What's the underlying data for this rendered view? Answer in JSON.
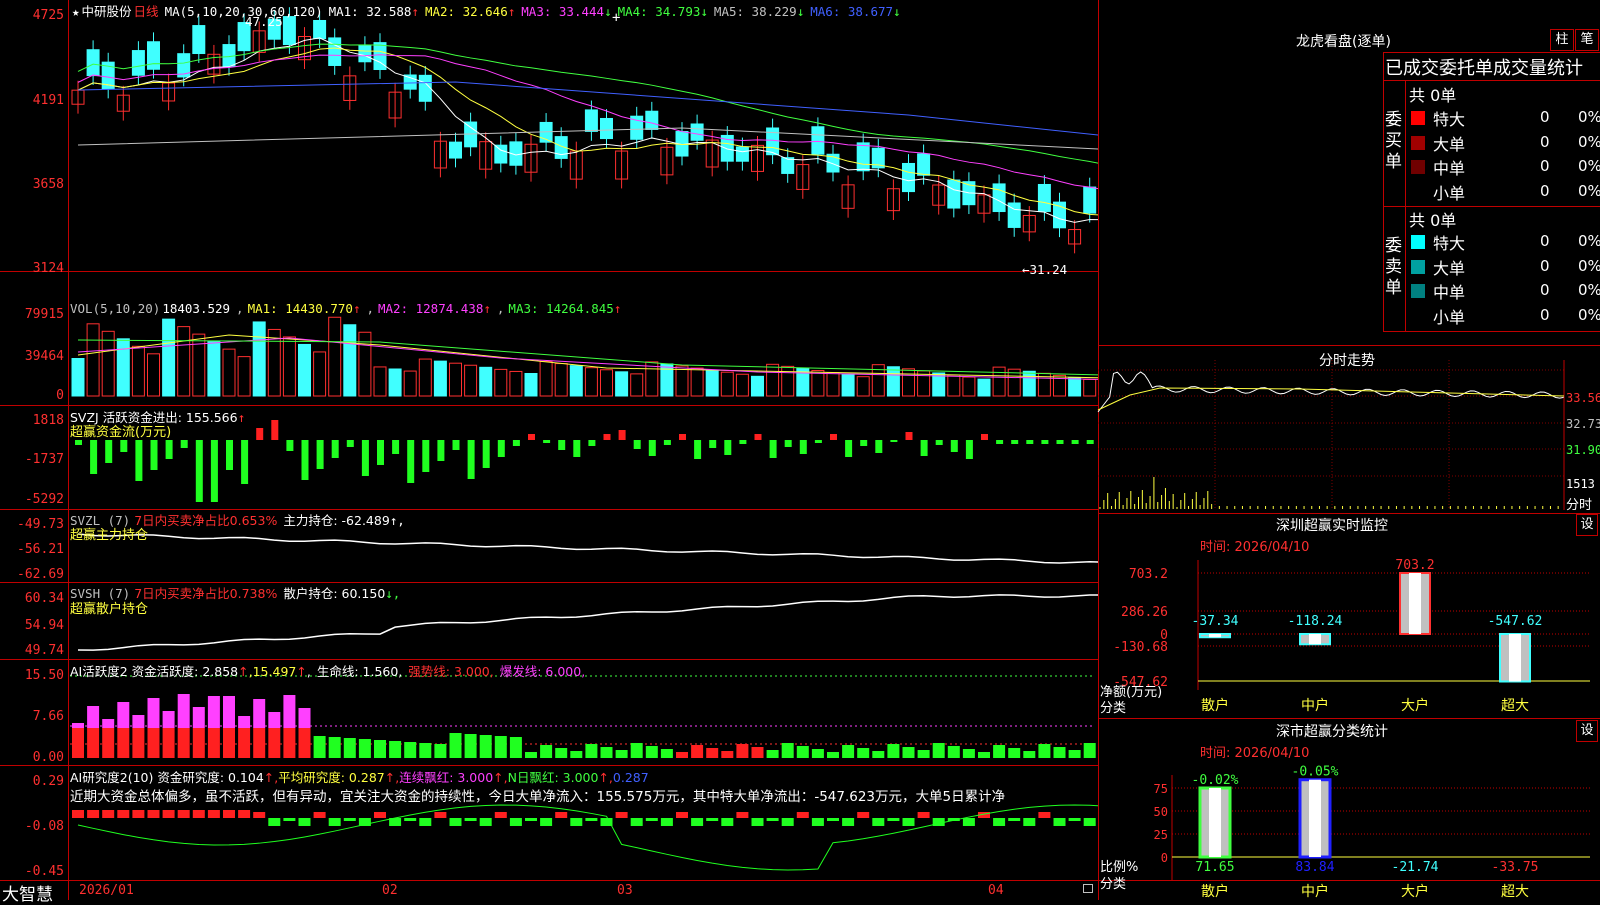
{
  "stock": {
    "star": "★",
    "name": "中研股份",
    "period": "日线",
    "ma_label": "MA(5,10,20,30,60,120)",
    "ma": [
      {
        "label": "MA1: 32.588",
        "arrow": "↑",
        "color": "#ffffff"
      },
      {
        "label": "MA2: 32.646",
        "arrow": "↑",
        "color": "#ffff40"
      },
      {
        "label": "MA3: 33.444",
        "arrow": "↓",
        "color": "#ff40ff"
      },
      {
        "label": "MA4: 34.793",
        "arrow": "↓",
        "color": "#40ff40"
      },
      {
        "label": "MA5: 38.229",
        "arrow": "↓",
        "color": "#c0c0c0"
      },
      {
        "label": "MA6: 38.677",
        "arrow": "↓",
        "color": "#4060ff"
      }
    ],
    "high_mark": "47.25",
    "low_mark": "←31.24",
    "y_ticks": [
      "4725",
      "4191",
      "3658",
      "3124"
    ]
  },
  "vol": {
    "label": "VOL(5,10,20)",
    "value": "18403.529",
    "ma": [
      {
        "label": "MA1: 14430.770",
        "arrow": "↑",
        "color": "#ffff40"
      },
      {
        "label": "MA2: 12874.438",
        "arrow": "↑",
        "color": "#ff40ff"
      },
      {
        "label": "MA3: 14264.845",
        "arrow": "↑",
        "color": "#40ff40"
      }
    ],
    "y_ticks": [
      "79915",
      "39464",
      "0"
    ]
  },
  "svzj": {
    "label": "SVZJ  活跃资金进出: 155.566",
    "arrow": "↑",
    "sub": "超赢资金流(万元)",
    "y_ticks": [
      "1818",
      "-1737",
      "-5292"
    ]
  },
  "svzl": {
    "label": "SVZL (7)",
    "red": "7日内买卖净占比0.653%",
    "white": "主力持仓: -62.489",
    "arrow": "↑,",
    "sub": "超赢主力持仓",
    "y_ticks": [
      "-49.73",
      "-56.21",
      "-62.69"
    ]
  },
  "svsh": {
    "label": "SVSH (7)",
    "red": "7日内买卖净占比0.738%",
    "white": "散户持仓: 60.150",
    "arrow": "↓,",
    "sub": "超赢散户持仓",
    "y_ticks": [
      "60.34",
      "54.94",
      "49.74"
    ]
  },
  "ai1": {
    "label": "AI活跃度2 资金活跃度: 2.858",
    "a1": "↑",
    "v2": "15.497",
    "life": "生命线: 1.560,",
    "strong": "强势线: 3.000,",
    "burst": "爆发线: 6.000,",
    "y_ticks": [
      "15.50",
      "7.66",
      "0.00"
    ]
  },
  "ai2": {
    "label": "AI研究度2(10) 资金研究度: 0.104",
    "avg": "平均研究度: 0.287",
    "cont": "连续飘红: 3.000",
    "nday": "N日飘红: 3.000",
    "last": "0.287",
    "commentary": "近期大资金总体偏多，虽不活跃，但有异动，宜关注大资金的持续性，今日大单净流入：155.575万元，其中特大单净流出：-547.623万元，大单5日累计净",
    "y_ticks": [
      "0.29",
      "-0.08",
      "-0.45"
    ]
  },
  "xaxis": {
    "labels": [
      "2026/01",
      "02",
      "03",
      "04"
    ]
  },
  "brand": "大智慧",
  "dragon": {
    "title": "龙虎看盘(逐单)",
    "btn1": "柱",
    "btn2": "笔",
    "tabs": "已成交委托单成交量统计",
    "buy_label": "委买单",
    "sell_label": "委卖单",
    "buy_total": "共 0单",
    "sell_total": "共 0单",
    "buy_rows": [
      {
        "name": "特大",
        "count": "0",
        "pct": "0%",
        "color": "#ff0000"
      },
      {
        "name": "大单",
        "count": "0",
        "pct": "0%",
        "color": "#a00000"
      },
      {
        "name": "中单",
        "count": "0",
        "pct": "0%",
        "color": "#700000"
      },
      {
        "name": "小单",
        "count": "0",
        "pct": "0%",
        "color": ""
      }
    ],
    "sell_rows": [
      {
        "name": "特大",
        "count": "0",
        "pct": "0%",
        "color": "#00ffff"
      },
      {
        "name": "大单",
        "count": "0",
        "pct": "0%",
        "color": "#00a0a0"
      },
      {
        "name": "中单",
        "count": "0",
        "pct": "0%",
        "color": "#008080"
      },
      {
        "name": "小单",
        "count": "0",
        "pct": "0%",
        "color": ""
      }
    ]
  },
  "minute": {
    "title": "分时走势",
    "prices": [
      "33.56",
      "32.73",
      "31.90"
    ],
    "vol_label": "1513",
    "vol_unit": "分时"
  },
  "monitor": {
    "title": "深圳超赢实时监控",
    "btn": "设",
    "time": "时间: 2026/04/10",
    "y_ticks": [
      "703.2",
      "286.26",
      "0",
      "-130.68",
      "-547.62"
    ],
    "unit": "净额(万元)",
    "unit2": "分类",
    "bars": [
      {
        "cat": "散户",
        "value": -37.34,
        "label": "-37.34"
      },
      {
        "cat": "中户",
        "value": -118.24,
        "label": "-118.24"
      },
      {
        "cat": "大户",
        "value": 703.2,
        "label": "703.2"
      },
      {
        "cat": "超大",
        "value": -547.62,
        "label": "-547.62"
      }
    ]
  },
  "classify": {
    "title": "深市超赢分类统计",
    "btn": "设",
    "time": "时间: 2026/04/10",
    "y_ticks": [
      "75",
      "50",
      "25",
      "0"
    ],
    "unit": "比例%",
    "unit2": "分类",
    "bars": [
      {
        "cat": "散户",
        "top": "-0.02%",
        "bottom": "71.65",
        "h": 75,
        "color": "#40ff40"
      },
      {
        "cat": "中户",
        "top": "-0.05%",
        "bottom": "83.84",
        "h": 84,
        "color": "#2020ff"
      },
      {
        "cat": "大户",
        "top": "",
        "bottom": "-21.74",
        "h": 0,
        "color": "#40ffff"
      },
      {
        "cat": "超大",
        "top": "",
        "bottom": "-33.75",
        "h": 0,
        "color": "#ff3030"
      }
    ]
  }
}
